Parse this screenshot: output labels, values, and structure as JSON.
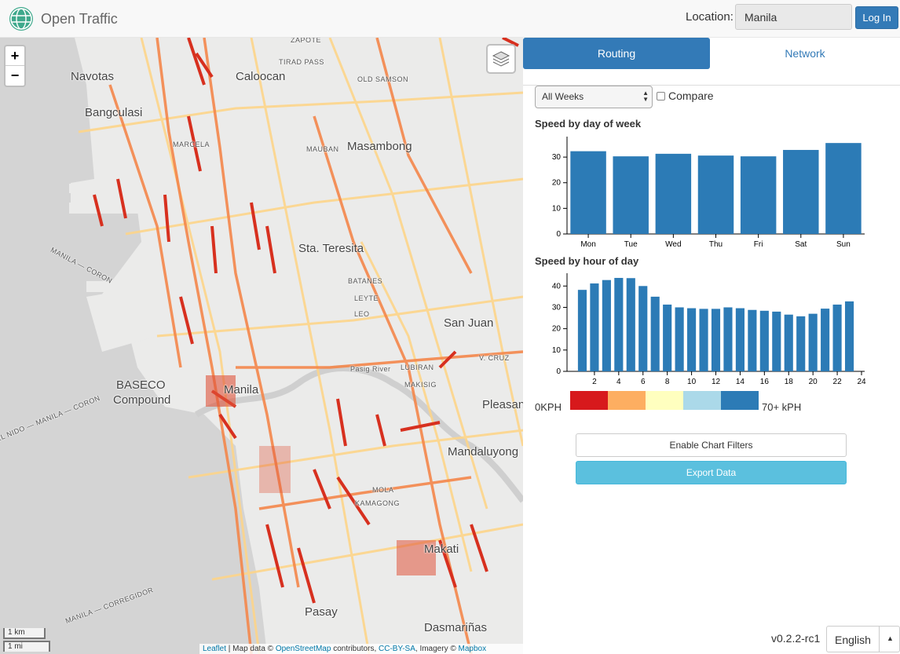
{
  "app": {
    "name": "Open Traffic"
  },
  "header": {
    "location_label": "Location:",
    "location_value": "Manila",
    "login_label": "Log In"
  },
  "map": {
    "zoom_in": "+",
    "zoom_out": "−",
    "labels": {
      "navotas": "Navotas",
      "caloocan": "Caloocan",
      "bangculasi": "Bangculasi",
      "masambong": "Masambong",
      "sta_teresita": "Sta. Teresita",
      "san_juan": "San Juan",
      "manila": "Manila",
      "baseco": "BASECO",
      "compound": "Compound",
      "pleasant": "Pleasan",
      "mandaluyong": "Mandaluyong",
      "pasay": "Pasay",
      "dasmarinas": "Dasmariñas",
      "makati": "Makati",
      "pasig_river": "Pasig River",
      "zapote": "ZAPOTE",
      "tirad_pass": "TIRAD PASS",
      "old_samson": "OLD SAMSON",
      "marcela": "MARCELA",
      "mauban": "MAUBAN",
      "batanes": "BATANES",
      "leyte": "LEYTE",
      "leo": "LEO",
      "lubiran": "LUBIRAN",
      "makisig": "MAKISIG",
      "kamagong": "KAMAGONG",
      "molave": "MOLA",
      "santa_cruz": "V. CRUZ",
      "manila_coron": "MANILA — CORON",
      "manila_corregidor": "MANILA — CORREGIDOR",
      "el_nido": "EL NIDO — MANILA — CORON"
    },
    "scale_km": "1 km",
    "scale_mi": "1 mi",
    "attribution": {
      "leaflet": "Leaflet",
      "sep": " | Map data © ",
      "osm": "OpenStreetMap",
      "contrib": " contributors, ",
      "license": "CC-BY-SA",
      "imagery": ", Imagery © ",
      "mapbox": "Mapbox"
    }
  },
  "panel": {
    "tabs": [
      {
        "label": "Routing"
      },
      {
        "label": "Network"
      }
    ],
    "week_select": "All Weeks",
    "compare_label": "Compare",
    "buttons": {
      "filters": "Enable Chart Filters",
      "export": "Export Data"
    },
    "legend": {
      "min_label": "0KPH",
      "max_label": "70+ kPH",
      "colors": [
        "#d7191c",
        "#fdae61",
        "#ffffbf",
        "#abd9e9",
        "#2c7bb6"
      ]
    },
    "version": "v0.2.2-rc1",
    "language": "English"
  },
  "chart_data": [
    {
      "type": "bar",
      "title": "Speed by day of week",
      "categories": [
        "Mon",
        "Tue",
        "Wed",
        "Thu",
        "Fri",
        "Sat",
        "Sun"
      ],
      "values": [
        32.3,
        30.3,
        31.3,
        30.6,
        30.3,
        32.8,
        35.5
      ],
      "ylim": [
        0,
        38
      ],
      "yticks": [
        0,
        10,
        20,
        30
      ],
      "color": "#2c7bb6"
    },
    {
      "type": "bar",
      "title": "Speed by hour of day",
      "x": [
        1,
        2,
        3,
        4,
        5,
        6,
        7,
        8,
        9,
        10,
        11,
        12,
        13,
        14,
        15,
        16,
        17,
        18,
        19,
        20,
        21,
        22,
        23
      ],
      "values": [
        38.2,
        41.2,
        42.8,
        43.8,
        43.7,
        40.0,
        35.0,
        31.3,
        30.0,
        29.6,
        29.3,
        29.3,
        30.0,
        29.6,
        28.8,
        28.4,
        28.0,
        26.6,
        25.8,
        27.0,
        29.4,
        31.3,
        32.8
      ],
      "xticks": [
        2,
        4,
        6,
        8,
        10,
        12,
        14,
        16,
        18,
        20,
        22,
        24
      ],
      "ylim": [
        0,
        46
      ],
      "yticks": [
        0,
        10,
        20,
        30,
        40
      ],
      "color": "#2c7bb6"
    }
  ]
}
